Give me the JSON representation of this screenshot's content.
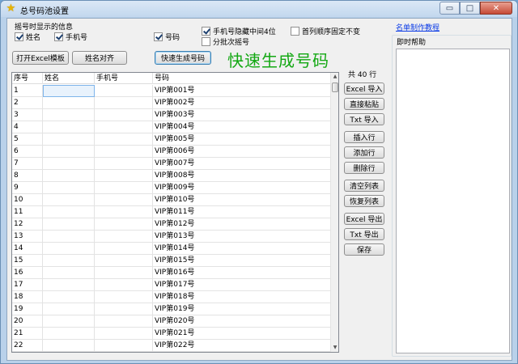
{
  "window": {
    "title": "总号码池设置",
    "controls": {
      "minimize": "▭",
      "maximize": "□",
      "close": "✕"
    }
  },
  "display_options": {
    "group_label": "摇号时显示的信息",
    "name": {
      "label": "姓名",
      "checked": true
    },
    "phone": {
      "label": "手机号",
      "checked": true
    },
    "number": {
      "label": "号码",
      "checked": true
    }
  },
  "settings": {
    "hide_phone_middle": {
      "label": "手机号隐藏中间4位",
      "checked": true
    },
    "fix_first_column": {
      "label": "首列顺序固定不变",
      "checked": false
    },
    "batch_draw": {
      "label": "分批次摇号",
      "checked": false
    }
  },
  "buttons": {
    "open_excel_template": "打开Excel模板",
    "align_names": "姓名对齐",
    "quick_generate": "快速生成号码"
  },
  "headline": "快速生成号码",
  "table": {
    "columns": [
      "序号",
      "姓名",
      "手机号",
      "号码"
    ],
    "rows": [
      [
        "1",
        "",
        "",
        "VIP第001号"
      ],
      [
        "2",
        "",
        "",
        "VIP第002号"
      ],
      [
        "3",
        "",
        "",
        "VIP第003号"
      ],
      [
        "4",
        "",
        "",
        "VIP第004号"
      ],
      [
        "5",
        "",
        "",
        "VIP第005号"
      ],
      [
        "6",
        "",
        "",
        "VIP第006号"
      ],
      [
        "7",
        "",
        "",
        "VIP第007号"
      ],
      [
        "8",
        "",
        "",
        "VIP第008号"
      ],
      [
        "9",
        "",
        "",
        "VIP第009号"
      ],
      [
        "10",
        "",
        "",
        "VIP第010号"
      ],
      [
        "11",
        "",
        "",
        "VIP第011号"
      ],
      [
        "12",
        "",
        "",
        "VIP第012号"
      ],
      [
        "13",
        "",
        "",
        "VIP第013号"
      ],
      [
        "14",
        "",
        "",
        "VIP第014号"
      ],
      [
        "15",
        "",
        "",
        "VIP第015号"
      ],
      [
        "16",
        "",
        "",
        "VIP第016号"
      ],
      [
        "17",
        "",
        "",
        "VIP第017号"
      ],
      [
        "18",
        "",
        "",
        "VIP第018号"
      ],
      [
        "19",
        "",
        "",
        "VIP第019号"
      ],
      [
        "20",
        "",
        "",
        "VIP第020号"
      ],
      [
        "21",
        "",
        "",
        "VIP第021号"
      ],
      [
        "22",
        "",
        "",
        "VIP第022号"
      ]
    ]
  },
  "row_count_label": "共 40 行",
  "side_buttons": {
    "excel_import": "Excel 导入",
    "paste": "直接粘贴",
    "txt_import": "Txt 导入",
    "insert_row": "插入行",
    "add_row": "添加行",
    "delete_row": "删除行",
    "clear_list": "清空列表",
    "restore_list": "恢复列表",
    "excel_export": "Excel 导出",
    "txt_export": "Txt 导出",
    "save": "保存"
  },
  "help": {
    "link": "名单制作教程",
    "caption": "即时帮助"
  }
}
